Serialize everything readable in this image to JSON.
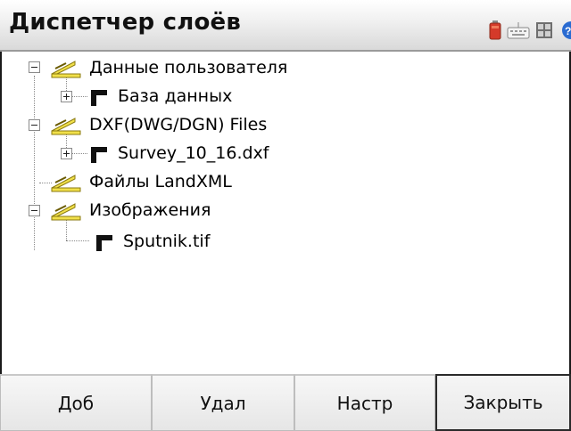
{
  "app": {
    "title": "Диспетчер слоёв"
  },
  "tree": [
    {
      "label": "Данные пользователя"
    },
    {
      "label": "База данных"
    },
    {
      "label": "DXF(DWG/DGN) Files"
    },
    {
      "label": "Survey_10_16.dxf"
    },
    {
      "label": "Файлы LandXML"
    },
    {
      "label": "Изображения"
    },
    {
      "label": "Sputnik.tif"
    }
  ],
  "buttons": {
    "add": "Доб",
    "delete": "Удал",
    "settings": "Настр",
    "close": "Закрыть"
  },
  "icons": {
    "folder": "layer-folder-icon",
    "layer": "layer-file-icon",
    "battery": "battery-icon",
    "keyboard": "keyboard-icon",
    "grid": "grid-icon",
    "help": "help-icon"
  },
  "colors": {
    "folder_yellow": "#e8d23a",
    "battery_red": "#d43a2a",
    "help_blue": "#2a6bd1"
  }
}
